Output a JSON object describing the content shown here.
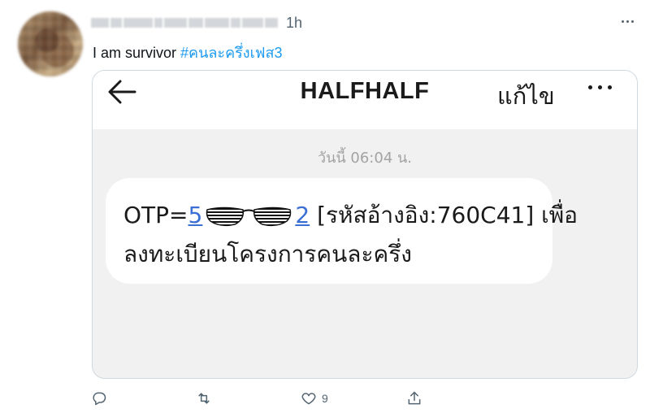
{
  "tweet": {
    "time": "1h",
    "text_prefix": "I am survivor ",
    "hashtag": "#คนละครึ่งเฟส3",
    "more_icon": "more-horizontal-icon"
  },
  "embedded": {
    "title": "HALFHALF",
    "edit_label": "แก้ไข",
    "message_time": "วันนี้ 06:04 น.",
    "message": {
      "otp_prefix": "OTP=",
      "otp_visible_start": "5",
      "otp_visible_end": "2",
      "reference": "[รหัสอ้างอิง:760C41] เพื่อ",
      "line2": "ลงทะเบียนโครงการคนละครึ่ง"
    },
    "colors": {
      "link": "#3b6fd4",
      "bubble": "#ffffff",
      "background": "#f1f1f1"
    }
  },
  "actions": {
    "reply_icon": "reply-icon",
    "retweet_icon": "retweet-icon",
    "like_icon": "heart-icon",
    "like_count": "9",
    "share_icon": "share-icon"
  },
  "colors": {
    "hashtag": "#1d9bf0",
    "secondary_text": "#536471"
  }
}
